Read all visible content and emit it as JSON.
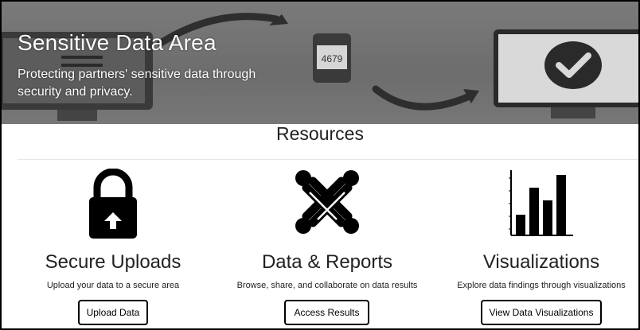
{
  "hero": {
    "title": "Sensitive Data Area",
    "subtitle": "Protecting partners' sensitive data through security and privacy.",
    "phone_code": "4679"
  },
  "resources": {
    "heading": "Resources",
    "cards": [
      {
        "title": "Secure Uploads",
        "description": "Upload your data to a secure area",
        "button": "Upload Data",
        "icon": "lock-icon"
      },
      {
        "title": "Data & Reports",
        "description": "Browse, share, and collaborate on data results",
        "button": "Access Results",
        "icon": "joomla-icon"
      },
      {
        "title": "Visualizations",
        "description": "Explore data findings through visualizations",
        "button": "View Data Visualizations",
        "icon": "bar-chart-icon"
      }
    ]
  },
  "colors": {
    "hero_bg": "#707070",
    "text": "#222222",
    "button_border": "#000000"
  }
}
